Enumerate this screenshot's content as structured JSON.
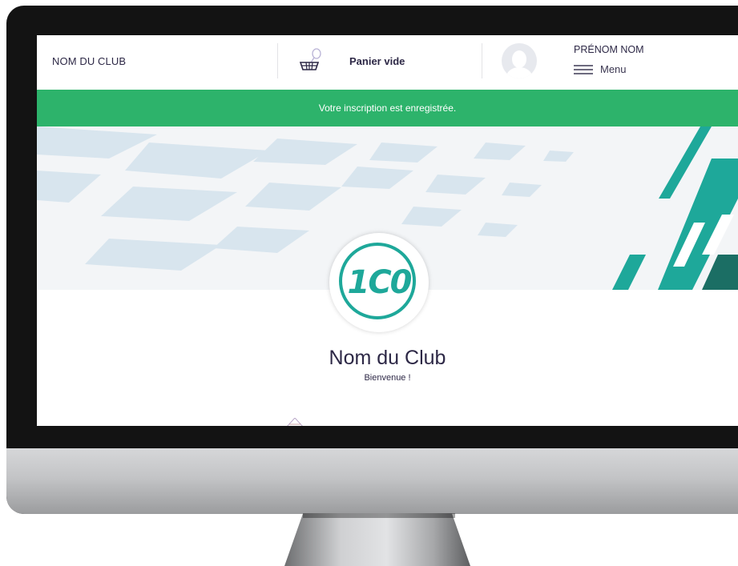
{
  "header": {
    "club_name": "NOM DU CLUB",
    "cart_label": "Panier vide",
    "cart_icon": "basket-icon",
    "user_name": "PRÉNOM NOM",
    "menu_label": "Menu",
    "menu_icon": "hamburger-icon",
    "avatar_icon": "user-avatar-icon"
  },
  "banner": {
    "message": "Votre inscription est enregistrée.",
    "color": "#2db36b"
  },
  "hero": {
    "logo_text": "1C0",
    "logo_color": "#1ea89a"
  },
  "club": {
    "title": "Nom du Club",
    "subtitle": "Bienvenue !"
  }
}
